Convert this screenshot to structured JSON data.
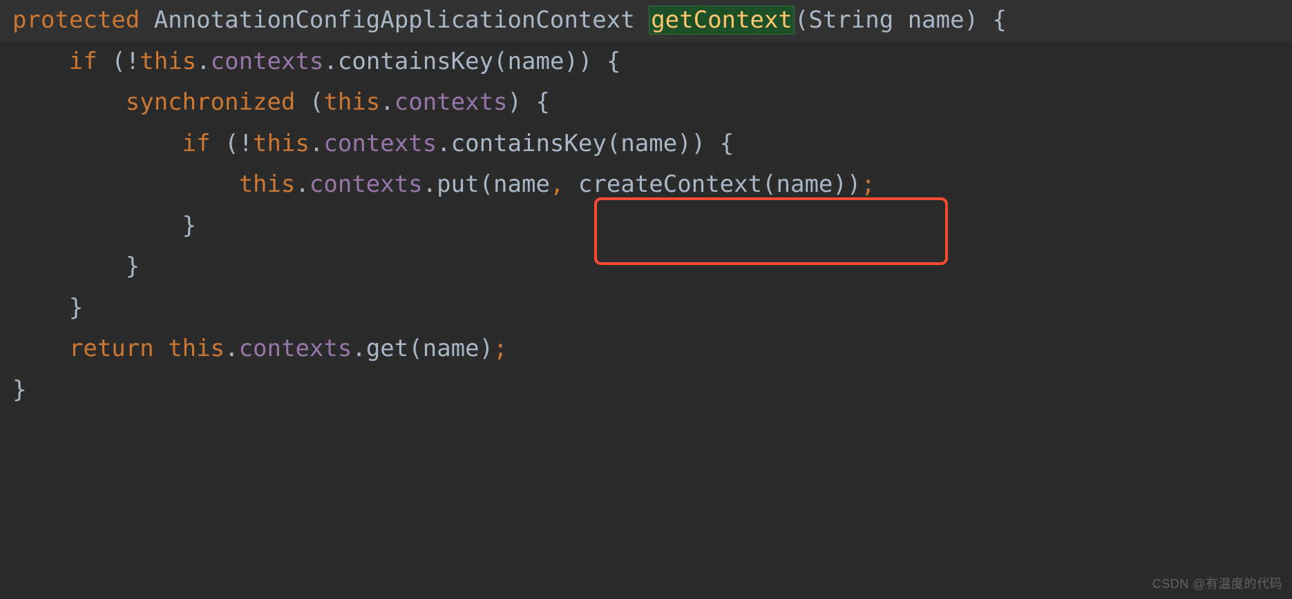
{
  "code": {
    "sig": {
      "protected": "protected",
      "type": "AnnotationConfigApplicationContext",
      "method": "getContext",
      "params_open": "(",
      "param_type": "String",
      "param_name": "name",
      "params_close": ")",
      "brace": "{"
    },
    "l2": {
      "if": "if",
      "open": "(!",
      "this": "this",
      "dot1": ".",
      "field": "contexts",
      "dot2": ".",
      "call": "containsKey",
      "arg_open": "(",
      "arg": "name",
      "arg_close": "))",
      "brace": "{"
    },
    "l3": {
      "sync": "synchronized",
      "open": "(",
      "this": "this",
      "dot": ".",
      "field": "contexts",
      "close": ")",
      "brace": "{"
    },
    "l4": {
      "if": "if",
      "open": "(!",
      "this": "this",
      "dot1": ".",
      "field": "contexts",
      "dot2": ".",
      "call": "containsKey",
      "arg_open": "(",
      "arg": "name",
      "arg_close": "))",
      "brace": "{"
    },
    "l5": {
      "this": "this",
      "dot1": ".",
      "field": "contexts",
      "dot2": ".",
      "put": "put",
      "open": "(",
      "arg1": "name",
      "comma": ",",
      "create": "createContext",
      "open2": "(",
      "arg2": "name",
      "close2": "))",
      "semi": ";"
    },
    "l6": {
      "brace": "}"
    },
    "l7": {
      "brace": "}"
    },
    "l8": {
      "brace": "}"
    },
    "l9": {
      "return": "return",
      "this": "this",
      "dot1": ".",
      "field": "contexts",
      "dot2": ".",
      "get": "get",
      "open": "(",
      "arg": "name",
      "close": ")",
      "semi": ";"
    },
    "l10": {
      "brace": "}"
    }
  },
  "watermark": "CSDN @有温度的代码"
}
